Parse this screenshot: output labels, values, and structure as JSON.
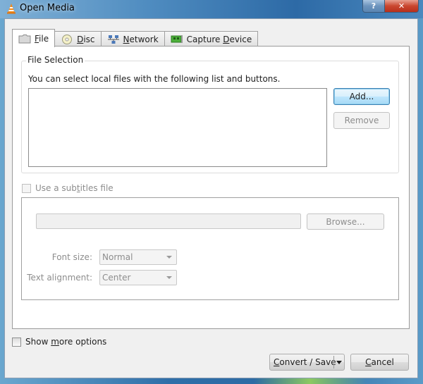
{
  "window": {
    "title": "Open Media",
    "help_label": "?",
    "close_label": "✕"
  },
  "tabs": [
    {
      "label_prefix": "",
      "mnemonic": "F",
      "label_suffix": "ile",
      "icon": "folder-icon",
      "active": true
    },
    {
      "label_prefix": "",
      "mnemonic": "D",
      "label_suffix": "isc",
      "icon": "disc-icon",
      "active": false
    },
    {
      "label_prefix": "",
      "mnemonic": "N",
      "label_suffix": "etwork",
      "icon": "network-icon",
      "active": false
    },
    {
      "label_prefix": "Capture ",
      "mnemonic": "D",
      "label_suffix": "evice",
      "icon": "capture-card-icon",
      "active": false
    }
  ],
  "file_selection": {
    "title": "File Selection",
    "description": "You can select local files with the following list and buttons.",
    "files": [],
    "add_label": "Add...",
    "remove_label": "Remove"
  },
  "subtitles": {
    "checkbox_prefix": "Use a sub",
    "checkbox_mnemonic": "t",
    "checkbox_suffix": "itles file",
    "checked": false,
    "path_value": "",
    "browse_label": "Browse...",
    "font_size_label": "Font size:",
    "font_size_value": "Normal",
    "alignment_label": "Text alignment:",
    "alignment_value": "Center"
  },
  "more_options": {
    "prefix": "Show ",
    "mnemonic": "m",
    "suffix": "ore options",
    "checked": false
  },
  "footer": {
    "convert_mnemonic": "C",
    "convert_suffix": "onvert / Save",
    "cancel_mnemonic": "C",
    "cancel_suffix": "ancel"
  }
}
